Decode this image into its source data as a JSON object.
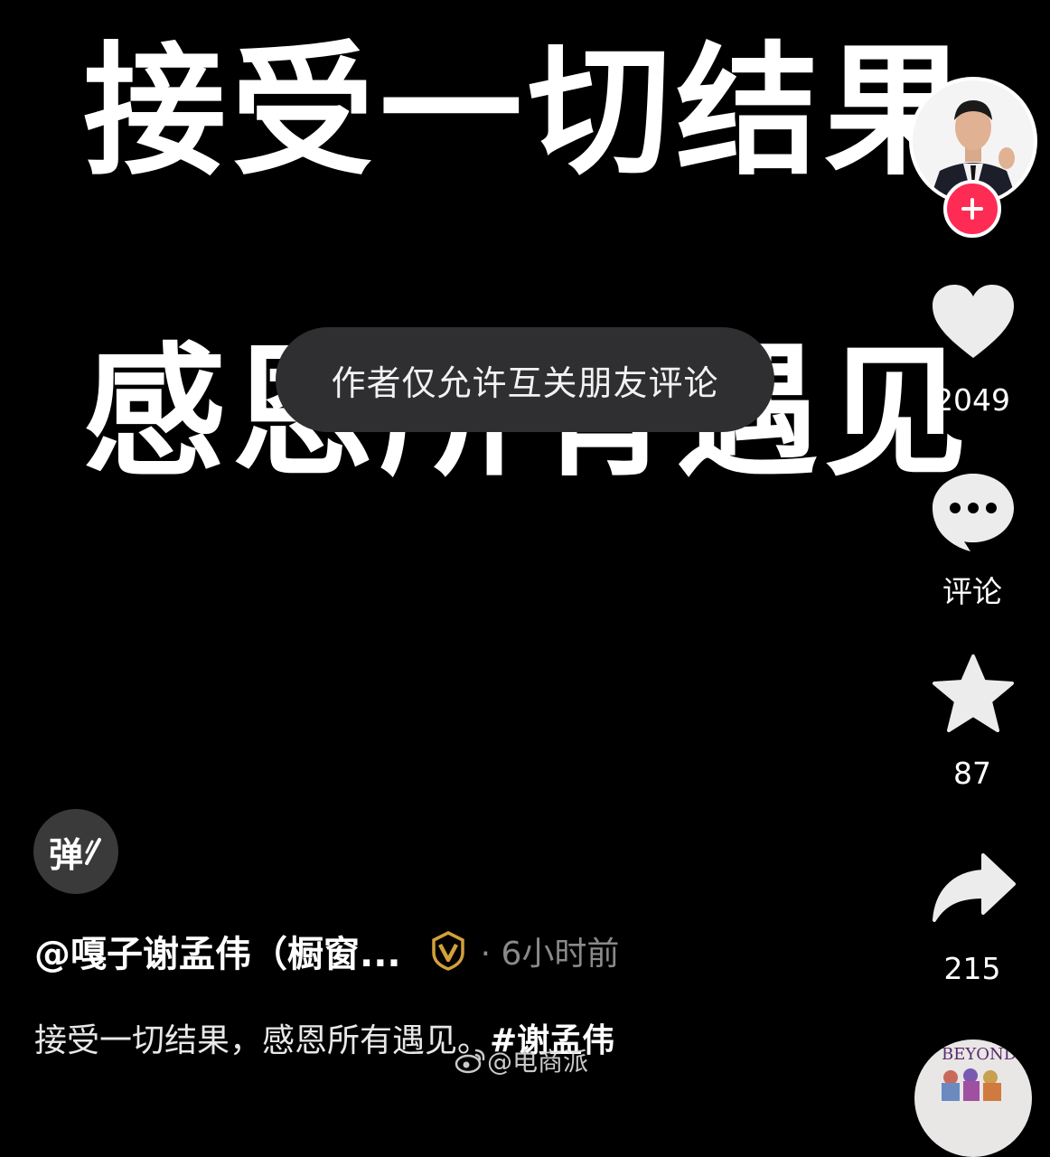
{
  "video": {
    "line1": "接受一切结果",
    "line2": "感恩所有遇见"
  },
  "toast": {
    "text": "作者仅允许互关朋友评论"
  },
  "sidebar": {
    "like_count": "2049",
    "comment_label": "评论",
    "favorite_count": "87",
    "share_count": "215",
    "disc_text": "BEYOND"
  },
  "bottom": {
    "danmu_label": "弹",
    "author": "@嘎子谢孟伟（橱窗...",
    "time": "· 6小时前",
    "caption_text": "接受一切结果，感恩所有遇见。",
    "hashtag": "#谢孟伟",
    "watermark": "@电商派"
  },
  "colors": {
    "follow": "#fe2c55",
    "verified": "#d3a13a",
    "background": "#000000"
  },
  "icons": [
    "heart-icon",
    "comment-icon",
    "star-icon",
    "share-icon",
    "plus-icon",
    "verified-icon",
    "weibo-icon"
  ]
}
